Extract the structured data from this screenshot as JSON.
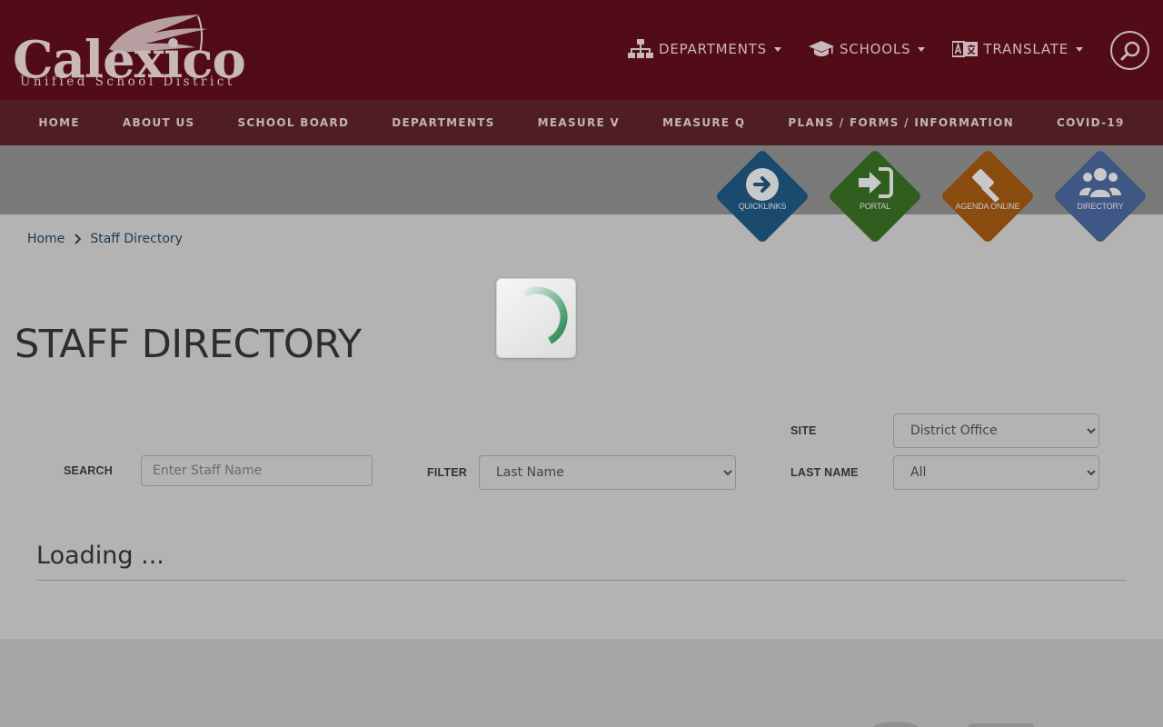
{
  "logo": {
    "name": "Calexico",
    "subtitle": "Unified School District"
  },
  "top_nav": [
    {
      "label": "DEPARTMENTS",
      "icon": "sitemap-icon"
    },
    {
      "label": "SCHOOLS",
      "icon": "graduation-cap-icon"
    },
    {
      "label": "TRANSLATE",
      "icon": "language-icon"
    }
  ],
  "main_nav": [
    "HOME",
    "ABOUT US",
    "SCHOOL BOARD",
    "DEPARTMENTS",
    "MEASURE V",
    "MEASURE Q",
    "PLANS / FORMS / INFORMATION",
    "COVID-19"
  ],
  "quicklinks": [
    {
      "label": "QUICKLINKS",
      "icon": "arrow-circle-right-icon",
      "color": "#1a4a6e"
    },
    {
      "label": "PORTAL",
      "icon": "sign-in-icon",
      "color": "#2f5e1f"
    },
    {
      "label": "AGENDA ONLINE",
      "icon": "gavel-icon",
      "color": "#8a4b0e"
    },
    {
      "label": "DIRECTORY",
      "icon": "users-icon",
      "color": "#3e5784"
    }
  ],
  "breadcrumb": {
    "home": "Home",
    "current": "Staff Directory"
  },
  "page_title": "STAFF DIRECTORY",
  "form": {
    "search_label": "SEARCH",
    "search_placeholder": "Enter Staff Name",
    "filter_label": "FILTER",
    "filter_value": "Last Name",
    "site_label": "SITE",
    "site_value": "District Office",
    "lastname_label": "LAST NAME",
    "lastname_value": "All"
  },
  "loading_text": "Loading ...",
  "colors": {
    "header_bg": "#520c18",
    "nav_bg": "#4f1e23",
    "spinner": "#1f8a4c"
  }
}
